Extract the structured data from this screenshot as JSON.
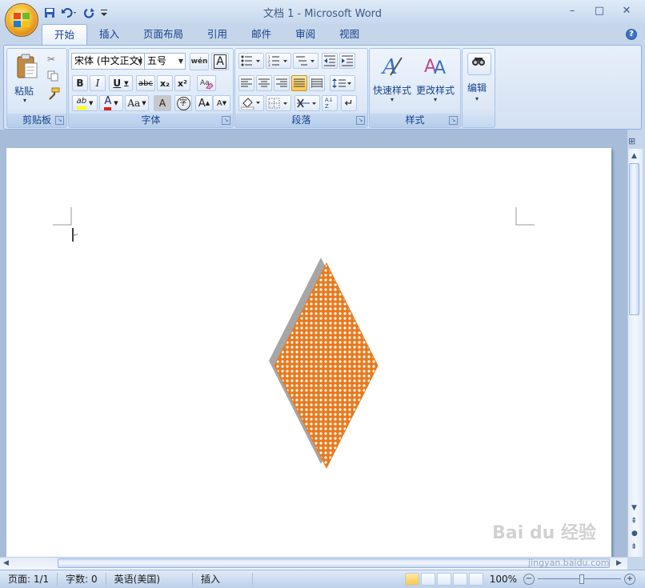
{
  "window": {
    "title": "文档 1 - Microsoft Word",
    "minimize_glyph": "–",
    "maximize_glyph": "□",
    "close_glyph": "✕"
  },
  "tabs": [
    "开始",
    "插入",
    "页面布局",
    "引用",
    "邮件",
    "审阅",
    "视图"
  ],
  "help": "?",
  "ribbon": {
    "clipboard": {
      "paste": "粘贴",
      "label": "剪贴板"
    },
    "font": {
      "name": "宋体 (中文正文)",
      "size": "五号",
      "label": "字体",
      "bold": "B",
      "italic": "I",
      "underline": "U",
      "strike": "abc",
      "subscript": "x₂",
      "superscript": "x²",
      "font_color": "A",
      "change_case": "Aa",
      "char_shade": "A",
      "enclose": "字",
      "grow": "A",
      "shrink": "A",
      "highlight": "ab",
      "wen": "wén",
      "border_a": "A"
    },
    "paragraph": {
      "label": "段落",
      "sort": "A↓Z"
    },
    "styles": {
      "quick": "快速样式",
      "change": "更改样式",
      "label": "样式"
    },
    "editing": {
      "label": "编辑"
    }
  },
  "document": {
    "shape": {
      "type": "diamond",
      "fill": "#e87a1e",
      "pattern": "dotted-grid",
      "shadow": "#a6a6a6"
    }
  },
  "status": {
    "page": "页面: 1/1",
    "words": "字数: 0",
    "language": "英语(美国)",
    "mode": "插入",
    "zoom": "100%"
  },
  "watermark": {
    "brand": "Bai du 经验",
    "url": "jingyan.baidu.com"
  }
}
